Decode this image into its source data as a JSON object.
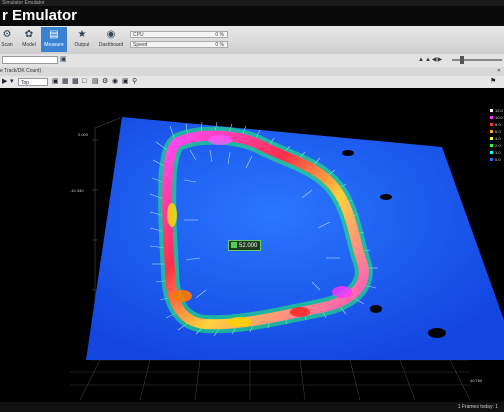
{
  "window": {
    "title": "Simulator Emulator"
  },
  "app": {
    "title": "r Emulator"
  },
  "ribbon": {
    "buttons": [
      {
        "label": "Scan",
        "icon": "scan-icon"
      },
      {
        "label": "Model",
        "icon": "model-icon"
      },
      {
        "label": "Measure",
        "icon": "measure-icon",
        "active": true
      },
      {
        "label": "Output",
        "icon": "output-icon"
      },
      {
        "label": "Dashboard",
        "icon": "dashboard-icon"
      }
    ],
    "meters": [
      {
        "label": "CPU",
        "value": "0 %"
      },
      {
        "label": "Speed",
        "value": "0 %"
      }
    ]
  },
  "panel": {
    "title": "e Track/DK Count)"
  },
  "viewtools": {
    "dropdown": "Top"
  },
  "viewport": {
    "marker_value": "52.000",
    "axis_labels": {
      "y_top": "2.000",
      "y_mid": "-10.340",
      "x_right": "40.760"
    },
    "legend": [
      {
        "label": "12.0",
        "color": "#ffffff"
      },
      {
        "label": "10.0",
        "color": "#ff33ff"
      },
      {
        "label": "8.0",
        "color": "#ff3333"
      },
      {
        "label": "6.0",
        "color": "#ffaa00"
      },
      {
        "label": "4.0",
        "color": "#ffff33"
      },
      {
        "label": "2.0",
        "color": "#33ff33"
      },
      {
        "label": "1.0",
        "color": "#00ffff"
      },
      {
        "label": "0.0",
        "color": "#3366ff"
      }
    ]
  },
  "status": {
    "text": "1 Frames today: 1"
  }
}
